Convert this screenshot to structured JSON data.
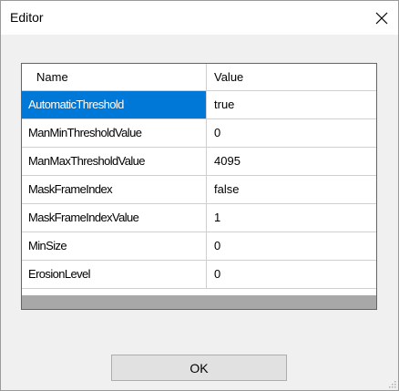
{
  "window": {
    "title": "Editor",
    "close_icon": "close-icon"
  },
  "grid": {
    "columns": [
      "Name",
      "Value"
    ],
    "rows": [
      {
        "name": "AutomaticThreshold",
        "value": "true",
        "selected": true
      },
      {
        "name": "ManMinThresholdValue",
        "value": "0",
        "selected": false
      },
      {
        "name": "ManMaxThresholdValue",
        "value": "4095",
        "selected": false
      },
      {
        "name": "MaskFrameIndex",
        "value": "false",
        "selected": false
      },
      {
        "name": "MaskFrameIndexValue",
        "value": "1",
        "selected": false
      },
      {
        "name": "MinSize",
        "value": "0",
        "selected": false
      },
      {
        "name": "ErosionLevel",
        "value": "0",
        "selected": false
      }
    ],
    "selection_color": "#0078d7"
  },
  "buttons": {
    "ok_label": "OK"
  }
}
